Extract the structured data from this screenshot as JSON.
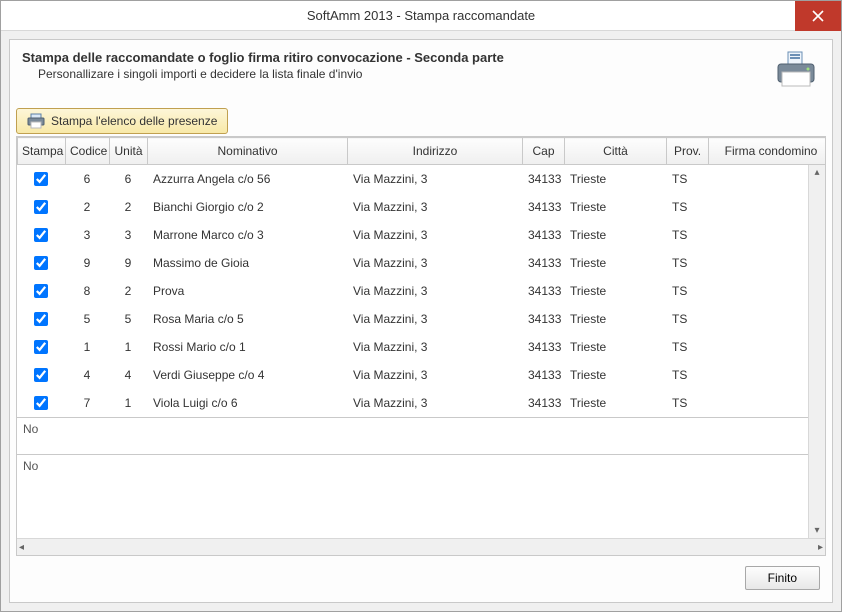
{
  "window": {
    "title": "SoftAmm 2013 - Stampa raccomandate"
  },
  "header": {
    "title": "Stampa delle raccomandate o foglio firma ritiro convocazione - Seconda parte",
    "subtitle": "Personallizare i singoli importi e decidere la lista finale d'invio"
  },
  "toolbar": {
    "print_presenze_label": "Stampa l'elenco delle presenze"
  },
  "columns": {
    "stampa": "Stampa",
    "codice": "Codice",
    "unita": "Unità",
    "nominativo": "Nominativo",
    "indirizzo": "Indirizzo",
    "cap": "Cap",
    "citta": "Città",
    "prov": "Prov.",
    "firma": "Firma condomino"
  },
  "rows": [
    {
      "checked": true,
      "codice": "6",
      "unita": "6",
      "nominativo": "Azzurra Angela c/o 56",
      "indirizzo": "Via Mazzini, 3",
      "cap": "34133",
      "citta": "Trieste",
      "prov": "TS",
      "firma": ""
    },
    {
      "checked": true,
      "codice": "2",
      "unita": "2",
      "nominativo": "Bianchi Giorgio c/o 2",
      "indirizzo": "Via Mazzini, 3",
      "cap": "34133",
      "citta": "Trieste",
      "prov": "TS",
      "firma": ""
    },
    {
      "checked": true,
      "codice": "3",
      "unita": "3",
      "nominativo": "Marrone Marco c/o 3",
      "indirizzo": "Via Mazzini, 3",
      "cap": "34133",
      "citta": "Trieste",
      "prov": "TS",
      "firma": ""
    },
    {
      "checked": true,
      "codice": "9",
      "unita": "9",
      "nominativo": "Massimo de Gioia",
      "indirizzo": "Via Mazzini, 3",
      "cap": "34133",
      "citta": "Trieste",
      "prov": "TS",
      "firma": ""
    },
    {
      "checked": true,
      "codice": "8",
      "unita": "2",
      "nominativo": "Prova",
      "indirizzo": "Via Mazzini, 3",
      "cap": "34133",
      "citta": "Trieste",
      "prov": "TS",
      "firma": ""
    },
    {
      "checked": true,
      "codice": "5",
      "unita": "5",
      "nominativo": "Rosa Maria c/o 5",
      "indirizzo": "Via Mazzini, 3",
      "cap": "34133",
      "citta": "Trieste",
      "prov": "TS",
      "firma": ""
    },
    {
      "checked": true,
      "codice": "1",
      "unita": "1",
      "nominativo": "Rossi Mario c/o 1",
      "indirizzo": "Via Mazzini, 3",
      "cap": "34133",
      "citta": "Trieste",
      "prov": "TS",
      "firma": ""
    },
    {
      "checked": true,
      "codice": "4",
      "unita": "4",
      "nominativo": "Verdi Giuseppe c/o 4",
      "indirizzo": "Via Mazzini, 3",
      "cap": "34133",
      "citta": "Trieste",
      "prov": "TS",
      "firma": ""
    },
    {
      "checked": true,
      "codice": "7",
      "unita": "1",
      "nominativo": "Viola Luigi c/o 6",
      "indirizzo": "Via Mazzini, 3",
      "cap": "34133",
      "citta": "Trieste",
      "prov": "TS",
      "firma": ""
    }
  ],
  "summary_label": "No",
  "footer": {
    "finish_label": "Finito"
  }
}
